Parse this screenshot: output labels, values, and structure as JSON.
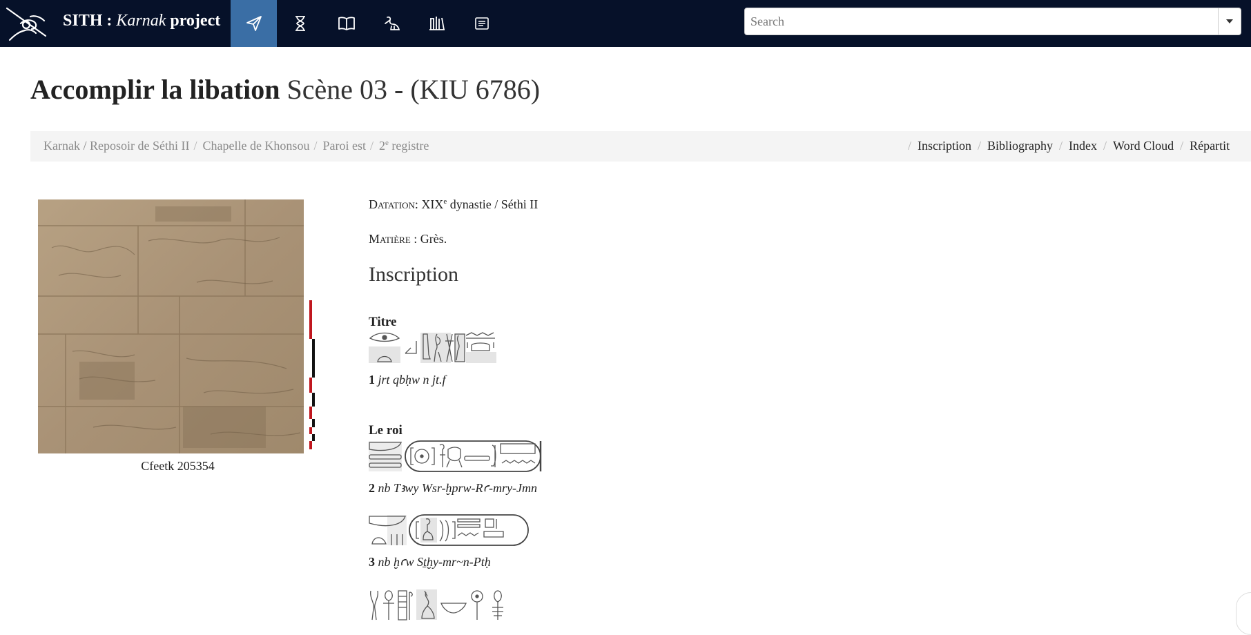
{
  "navbar": {
    "brand_prefix": "SITH : ",
    "brand_italic": "Karnak",
    "brand_suffix": " project",
    "icons": [
      "logo-icon",
      "paper-plane-icon",
      "hourglass-icon",
      "book-icon",
      "ibis-icon",
      "library-icon",
      "list-icon"
    ],
    "active_icon": "paper-plane-icon",
    "accent_color": "#3a6ea5",
    "background_color": "#061129",
    "search": {
      "placeholder": "Search",
      "value": ""
    }
  },
  "header": {
    "title_bold": "Accomplir la libation",
    "title_rest": "Scène 03 - (KIU 6786)"
  },
  "breadcrumb": {
    "items": [
      "Karnak / Reposoir de Séthi II",
      "Chapelle de Khonsou",
      "Paroi est"
    ],
    "last_prefix": "2",
    "last_sup": "e",
    "last_suffix": " registre"
  },
  "tabs": [
    "Inscription",
    "Bibliography",
    "Index",
    "Word Cloud",
    "Répartit"
  ],
  "figure": {
    "caption": "Cfeetk 205354"
  },
  "metadata": {
    "datation_label": "Datation",
    "datation_prefix": ": XIX",
    "datation_sup": "e",
    "datation_suffix": " dynastie / Séthi II",
    "matiere_label": "Matière",
    "matiere_value": " : Grès."
  },
  "inscription": {
    "heading": "Inscription",
    "groups": [
      {
        "label": "Titre",
        "number": "1",
        "translit": "jrt qbḥw n jt.f"
      },
      {
        "label": "Le roi",
        "number": "2",
        "translit": "nb Tꜣwy Wsr-ḫprw-Rꜥ-mry-Jmn"
      },
      {
        "label": "",
        "number": "3",
        "translit": "nb ḫꜥw Sṯḫy-mr~n-Ptḥ"
      }
    ]
  }
}
